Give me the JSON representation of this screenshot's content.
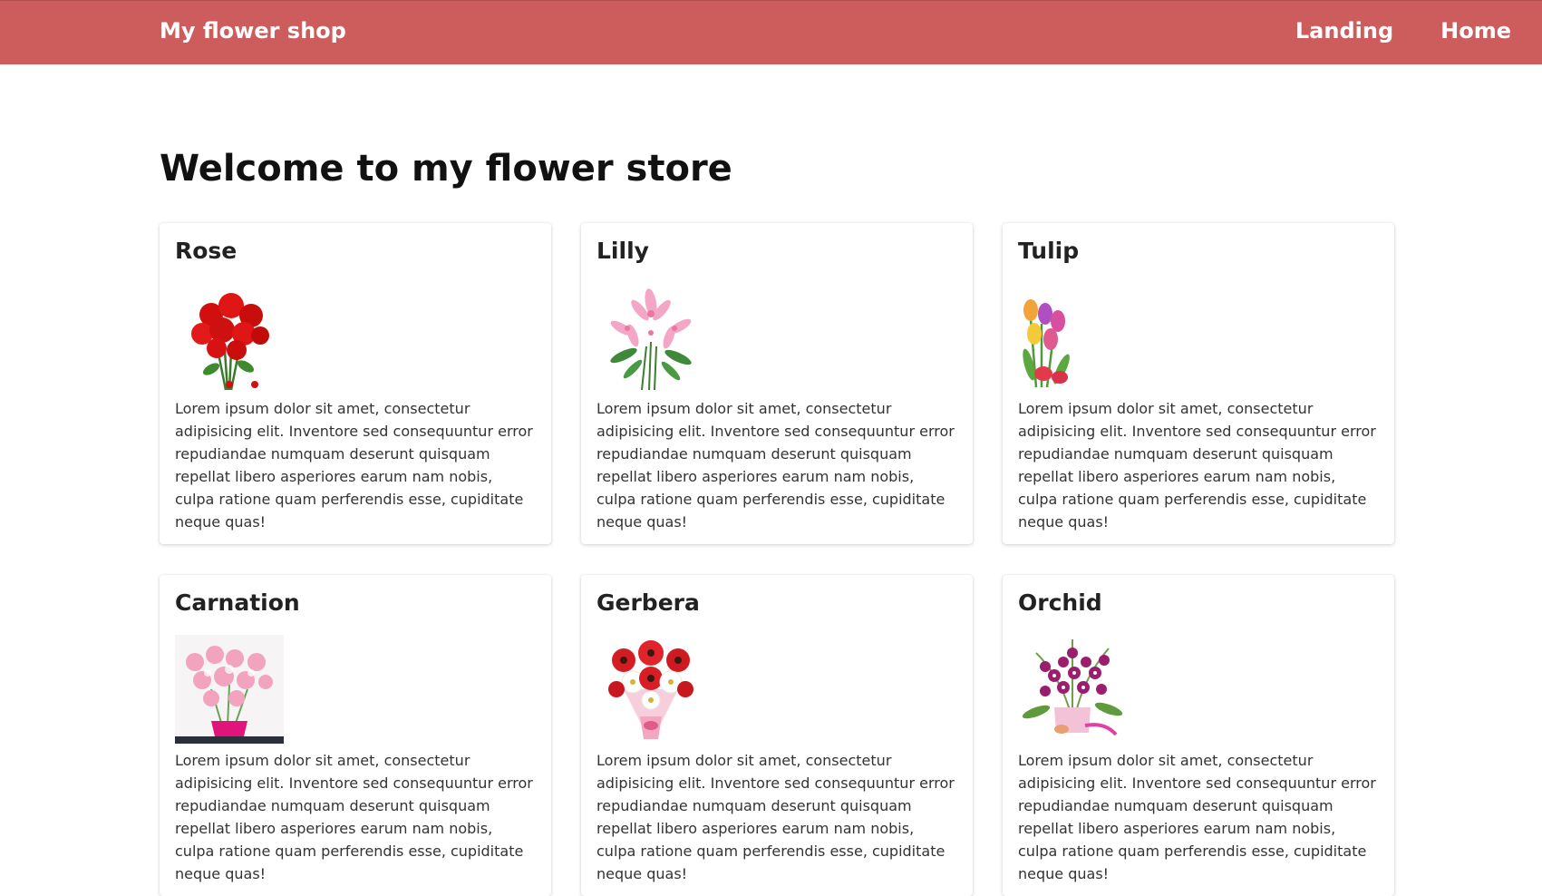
{
  "navbar": {
    "brand": "My flower shop",
    "links": [
      "Landing",
      "Home"
    ],
    "background_color": "#cd5c5c"
  },
  "main": {
    "title": "Welcome to my flower store",
    "cards": [
      {
        "title": "Rose",
        "image": "rose-bouquet-image",
        "text": "Lorem ipsum dolor sit amet, consectetur adipisicing elit. Inventore sed consequuntur error repudiandae numquam deserunt quisquam repellat libero asperiores earum nam nobis, culpa ratione quam perferendis esse, cupiditate neque quas!"
      },
      {
        "title": "Lilly",
        "image": "lily-bouquet-image",
        "text": "Lorem ipsum dolor sit amet, consectetur adipisicing elit. Inventore sed consequuntur error repudiandae numquam deserunt quisquam repellat libero asperiores earum nam nobis, culpa ratione quam perferendis esse, cupiditate neque quas!"
      },
      {
        "title": "Tulip",
        "image": "tulip-bouquet-image",
        "text": "Lorem ipsum dolor sit amet, consectetur adipisicing elit. Inventore sed consequuntur error repudiandae numquam deserunt quisquam repellat libero asperiores earum nam nobis, culpa ratione quam perferendis esse, cupiditate neque quas!"
      },
      {
        "title": "Carnation",
        "image": "carnation-bouquet-image",
        "text": "Lorem ipsum dolor sit amet, consectetur adipisicing elit. Inventore sed consequuntur error repudiandae numquam deserunt quisquam repellat libero asperiores earum nam nobis, culpa ratione quam perferendis esse, cupiditate neque quas!"
      },
      {
        "title": "Gerbera",
        "image": "gerbera-bouquet-image",
        "text": "Lorem ipsum dolor sit amet, consectetur adipisicing elit. Inventore sed consequuntur error repudiandae numquam deserunt quisquam repellat libero asperiores earum nam nobis, culpa ratione quam perferendis esse, cupiditate neque quas!"
      },
      {
        "title": "Orchid",
        "image": "orchid-bouquet-image",
        "text": "Lorem ipsum dolor sit amet, consectetur adipisicing elit. Inventore sed consequuntur error repudiandae numquam deserunt quisquam repellat libero asperiores earum nam nobis, culpa ratione quam perferendis esse, cupiditate neque quas!"
      }
    ]
  }
}
